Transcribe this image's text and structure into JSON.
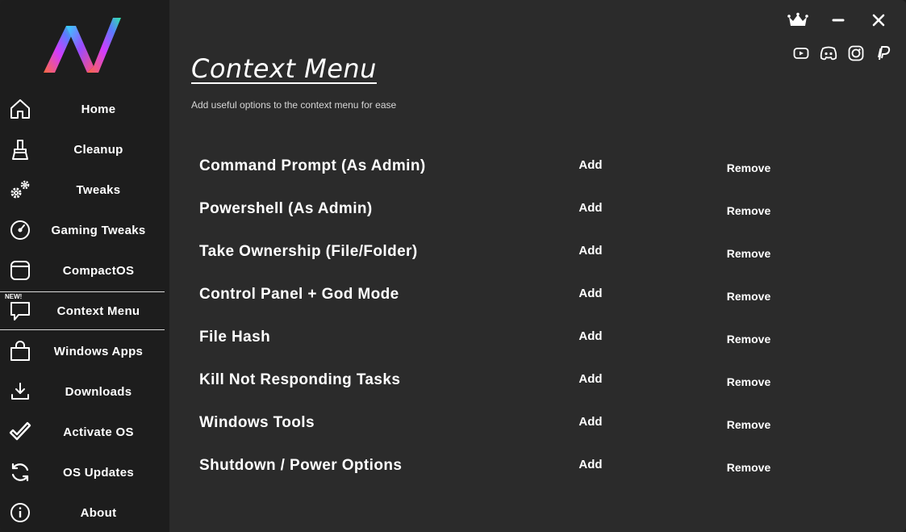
{
  "app": {
    "accent_gradient": [
      "#ff5a5f",
      "#a34bff",
      "#2fd6ff",
      "#3dff9a"
    ]
  },
  "sidebar": {
    "items": [
      {
        "label": "Home",
        "icon": "home-icon"
      },
      {
        "label": "Cleanup",
        "icon": "brush-icon"
      },
      {
        "label": "Tweaks",
        "icon": "gears-icon"
      },
      {
        "label": "Gaming Tweaks",
        "icon": "speedometer-icon"
      },
      {
        "label": "CompactOS",
        "icon": "window-icon"
      },
      {
        "label": "Context Menu",
        "icon": "chat-new-icon",
        "badge": "NEW!",
        "active": true
      },
      {
        "label": "Windows Apps",
        "icon": "shopping-bag-icon"
      },
      {
        "label": "Downloads",
        "icon": "download-icon"
      },
      {
        "label": "Activate OS",
        "icon": "checkmark-icon"
      },
      {
        "label": "OS Updates",
        "icon": "refresh-icon"
      },
      {
        "label": "About",
        "icon": "info-icon"
      }
    ]
  },
  "main": {
    "title": "Context Menu",
    "subtitle": "Add useful options to the context menu for ease",
    "add_label": "Add",
    "remove_label": "Remove",
    "rows": [
      {
        "label": "Command Prompt (As Admin)"
      },
      {
        "label": "Powershell (As Admin)"
      },
      {
        "label": "Take Ownership (File/Folder)"
      },
      {
        "label": "Control Panel + God Mode"
      },
      {
        "label": "File Hash"
      },
      {
        "label": "Kill Not Responding Tasks"
      },
      {
        "label": "Windows Tools"
      },
      {
        "label": "Shutdown / Power Options"
      }
    ]
  },
  "header": {
    "window_controls": [
      "crown-icon",
      "minimize-icon",
      "close-icon"
    ],
    "socials": [
      "youtube-icon",
      "discord-icon",
      "github-icon",
      "paypal-icon"
    ]
  }
}
